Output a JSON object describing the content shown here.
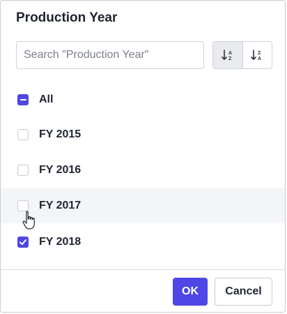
{
  "dialog": {
    "title": "Production Year"
  },
  "search": {
    "placeholder": "Search \"Production Year\"",
    "value": ""
  },
  "sort": {
    "ascending_icon": "sort-ascending-icon",
    "descending_icon": "sort-descending-icon",
    "active": "ascending"
  },
  "options": [
    {
      "label": "All",
      "state": "indeterminate"
    },
    {
      "label": "FY 2015",
      "state": "unchecked"
    },
    {
      "label": "FY 2016",
      "state": "unchecked"
    },
    {
      "label": "FY 2017",
      "state": "unchecked",
      "hovered": true
    },
    {
      "label": "FY 2018",
      "state": "checked"
    }
  ],
  "footer": {
    "ok_label": "OK",
    "cancel_label": "Cancel"
  },
  "colors": {
    "accent": "#4f46e5",
    "hover_row": "#f4f5f7"
  }
}
